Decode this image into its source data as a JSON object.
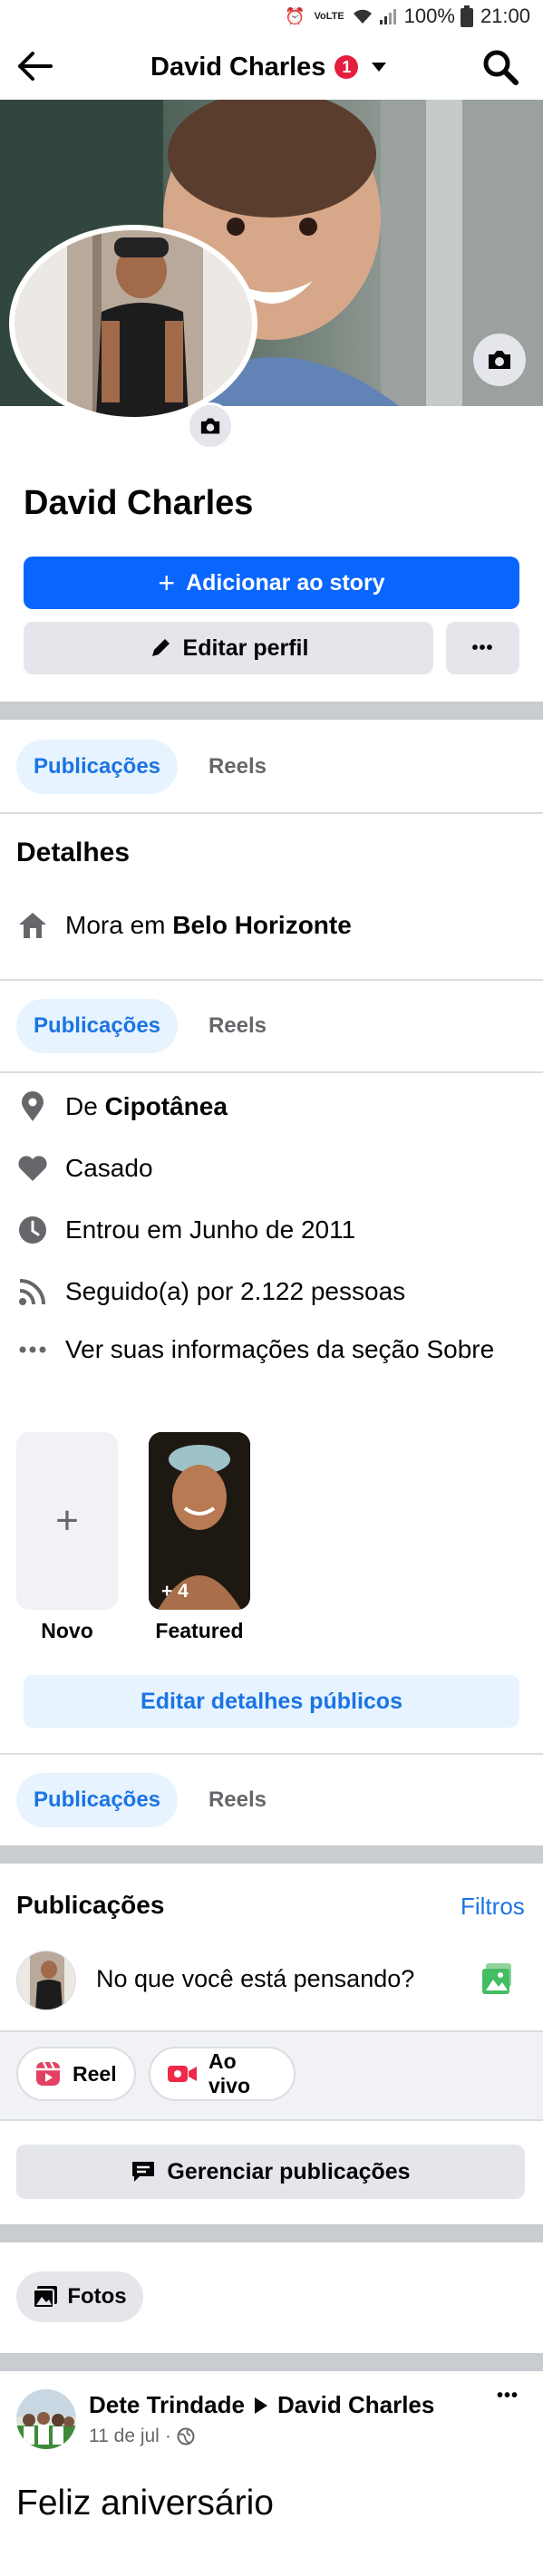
{
  "status_bar": {
    "network": "VoLTE",
    "battery": "100%",
    "time": "21:00"
  },
  "header": {
    "title": "David Charles",
    "badge_count": "1"
  },
  "profile": {
    "name": "David Charles",
    "add_story_label": "Adicionar ao story",
    "edit_profile_label": "Editar perfil",
    "more_label": "•••"
  },
  "tabs": {
    "posts": "Publicações",
    "reels": "Reels"
  },
  "details": {
    "heading": "Detalhes",
    "lives_prefix": "Mora em ",
    "lives_city": "Belo Horizonte",
    "from_prefix": "De ",
    "from_city": "Cipotânea",
    "relationship": "Casado",
    "joined": "Entrou em Junho de 2011",
    "followers": "Seguido(a) por 2.122 pessoas",
    "about_link": "Ver suas informações da seção Sobre"
  },
  "featured": {
    "new_label": "Novo",
    "featured_label": "Featured",
    "featured_count": "+ 4",
    "edit_public_details": "Editar detalhes públicos"
  },
  "publications": {
    "heading": "Publicações",
    "filters": "Filtros",
    "composer_placeholder": "No que você está pensando?",
    "reel_label": "Reel",
    "live_label": "Ao vivo",
    "manage_label": "Gerenciar publicações",
    "photos_label": "Fotos"
  },
  "post": {
    "author": "Dete Trindade",
    "target": "David Charles",
    "date": "11 de jul",
    "dot": "·",
    "more": "•••",
    "text": "Feliz aniversário"
  },
  "colors": {
    "brand_blue": "#0866ff",
    "link_blue": "#1b74e4",
    "tab_active_bg": "#e7f3ff",
    "badge_red": "#e41e3f",
    "separator_gray": "#c9ccd1",
    "button_gray": "#e4e6eb"
  }
}
